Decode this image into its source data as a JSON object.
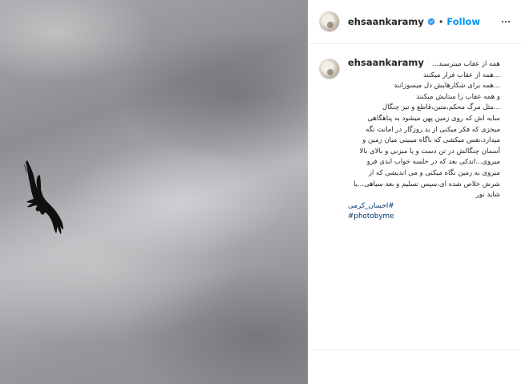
{
  "post": {
    "username": "ehsaankaramy",
    "follow_label": "Follow",
    "separator": "•",
    "caption_lines": [
      "همه از عقاب میترسند...",
      "...همه از عقاب فرار میکنند",
      "...همه برای شکارهایش دل میسوزانند",
      "و همه عقاب را ستایش میکنند",
      "...مثل مرگ محکم،متین،قاطع و تیز چنگال",
      "سایه اش که روی زمین پهن میشود به پناهگاهی",
      "میخزی که فکر میکنی از بد روزگار در امانت نگه",
      "میدارد،نفس میکشی که ناگاه میبینی میان زمین و",
      "آسمان چنگالش در تن دست و پا میزنی و بالای بالا",
      "میروی...اندکی بعد که در خلسه خواب ابدی فرو",
      "میروی به زمین نگاه میکنی و می اندیشی که از",
      "شرش خلاص شده ای،سپس تسلیم و بعد سیاهی...یا",
      "شاید نور"
    ],
    "hashtags": [
      "#احسان_کرمی",
      "#photobyme"
    ]
  },
  "icons": {
    "verified": "verified-badge-icon",
    "more": "more-options-icon",
    "bird": "eagle-silhouette"
  },
  "colors": {
    "link_blue": "#0095f6",
    "hashtag": "#00376b",
    "text": "#262626",
    "verified": "#3897f0"
  }
}
